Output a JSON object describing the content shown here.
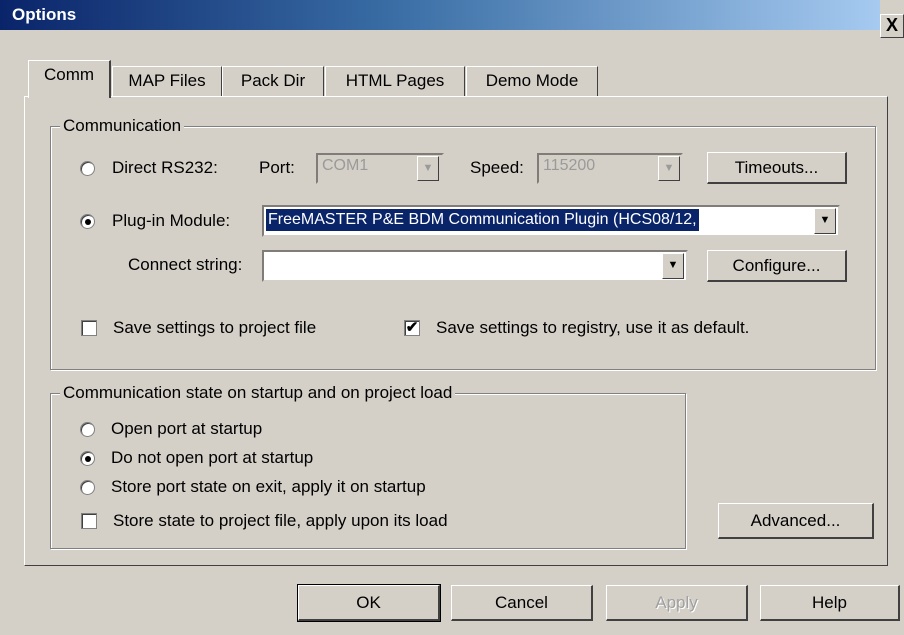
{
  "window": {
    "title": "Options",
    "close_glyph": "X"
  },
  "tabs": [
    {
      "label": "Comm"
    },
    {
      "label": "MAP Files"
    },
    {
      "label": "Pack Dir"
    },
    {
      "label": "HTML Pages"
    },
    {
      "label": "Demo Mode"
    }
  ],
  "communication": {
    "legend": "Communication",
    "direct_rs232_label": "Direct RS232:",
    "port_label": "Port:",
    "port_value": "COM1",
    "speed_label": "Speed:",
    "speed_value": "115200",
    "timeouts_button": "Timeouts...",
    "plugin_label": "Plug-in Module:",
    "plugin_value": "FreeMASTER P&E BDM Communication Plugin (HCS08/12,",
    "connect_label": "Connect string:",
    "connect_value": "",
    "configure_button": "Configure...",
    "save_project_label": "Save settings to project file",
    "save_registry_label": "Save settings to registry, use it as default.",
    "selected_mode": "plugin"
  },
  "startup": {
    "legend": "Communication state on startup and on project load",
    "open_port_label": "Open port at startup",
    "do_not_open_label": "Do not open port at startup",
    "store_port_label": "Store port state on exit, apply it on startup",
    "store_state_label": "Store state to project file, apply upon its load",
    "selected": "do_not_open"
  },
  "buttons": {
    "advanced": "Advanced...",
    "ok": "OK",
    "cancel": "Cancel",
    "apply": "Apply",
    "help": "Help"
  },
  "colors": {
    "title_start": "#0a246a",
    "title_end": "#a6caf0",
    "face": "#d4d0c8",
    "selection": "#0a246a"
  }
}
